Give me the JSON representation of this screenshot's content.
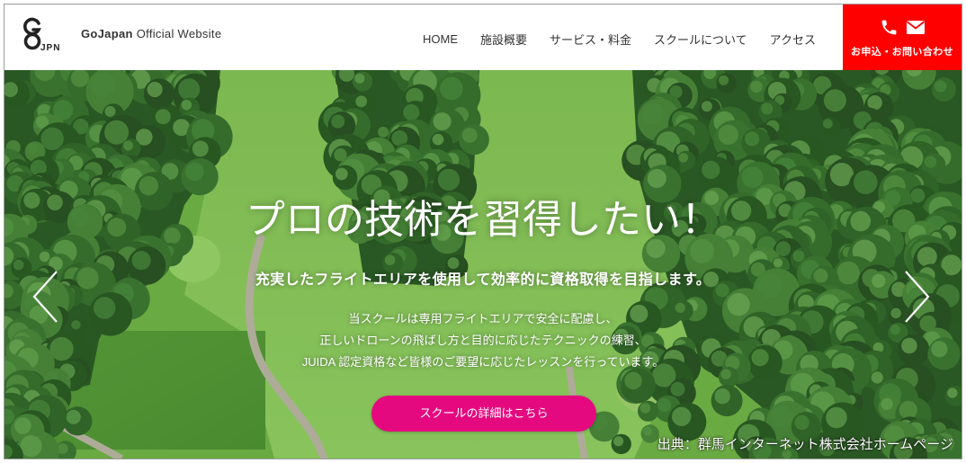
{
  "header": {
    "logo_text": "JPN",
    "brand": "GoJapan",
    "subtitle": "Official Website"
  },
  "nav": {
    "items": [
      {
        "label": "HOME"
      },
      {
        "label": "施設概要"
      },
      {
        "label": "サービス・料金"
      },
      {
        "label": "スクールについて"
      },
      {
        "label": "アクセス"
      }
    ]
  },
  "contact": {
    "label": "お申込・お問い合わせ",
    "phone_icon": "phone-icon",
    "mail_icon": "mail-icon"
  },
  "hero": {
    "heading": "プロの技術を習得したい！",
    "subheading": "充実したフライトエリアを使用して効率的に資格取得を目指します。",
    "description_lines": [
      "当スクールは専用フライトエリアで安全に配慮し、",
      "正しいドローンの飛ばし方と目的に応じたテクニックの練習、",
      "JUIDA 認定資格など皆様のご要望に応じたレッスンを行っています。"
    ],
    "cta_label": "スクールの詳細はこちら",
    "prev_icon": "chevron-left-icon",
    "next_icon": "chevron-right-icon"
  },
  "credit": "出典：群馬インターネット株式会社ホームページ",
  "colors": {
    "contact_bg": "#ff0000",
    "cta_bg": "#e5097f",
    "nav_text": "#333333",
    "hero_text": "#ffffff"
  }
}
